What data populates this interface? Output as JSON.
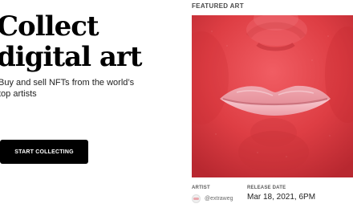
{
  "hero": {
    "title_line_1": "Collect",
    "title_line_2": "digital art",
    "subtitle": "Buy and sell NFTs from the world’s top artists",
    "button_label": "START COLLECTING"
  },
  "featured": {
    "label": "FEATURED ART",
    "artist_label": "ARTIST",
    "artist_handle": "@extraweg",
    "release_date_label": "RELEASE DATE",
    "release_date": "Mar 18, 2021, 6PM"
  },
  "colors": {
    "background": "#ffffff",
    "text": "#111111",
    "button": "#000000",
    "artwork_red": "#d93c3f",
    "lip_pink": "#f4b8c0"
  },
  "icons": {
    "avatar": "artist-avatar-icon"
  }
}
